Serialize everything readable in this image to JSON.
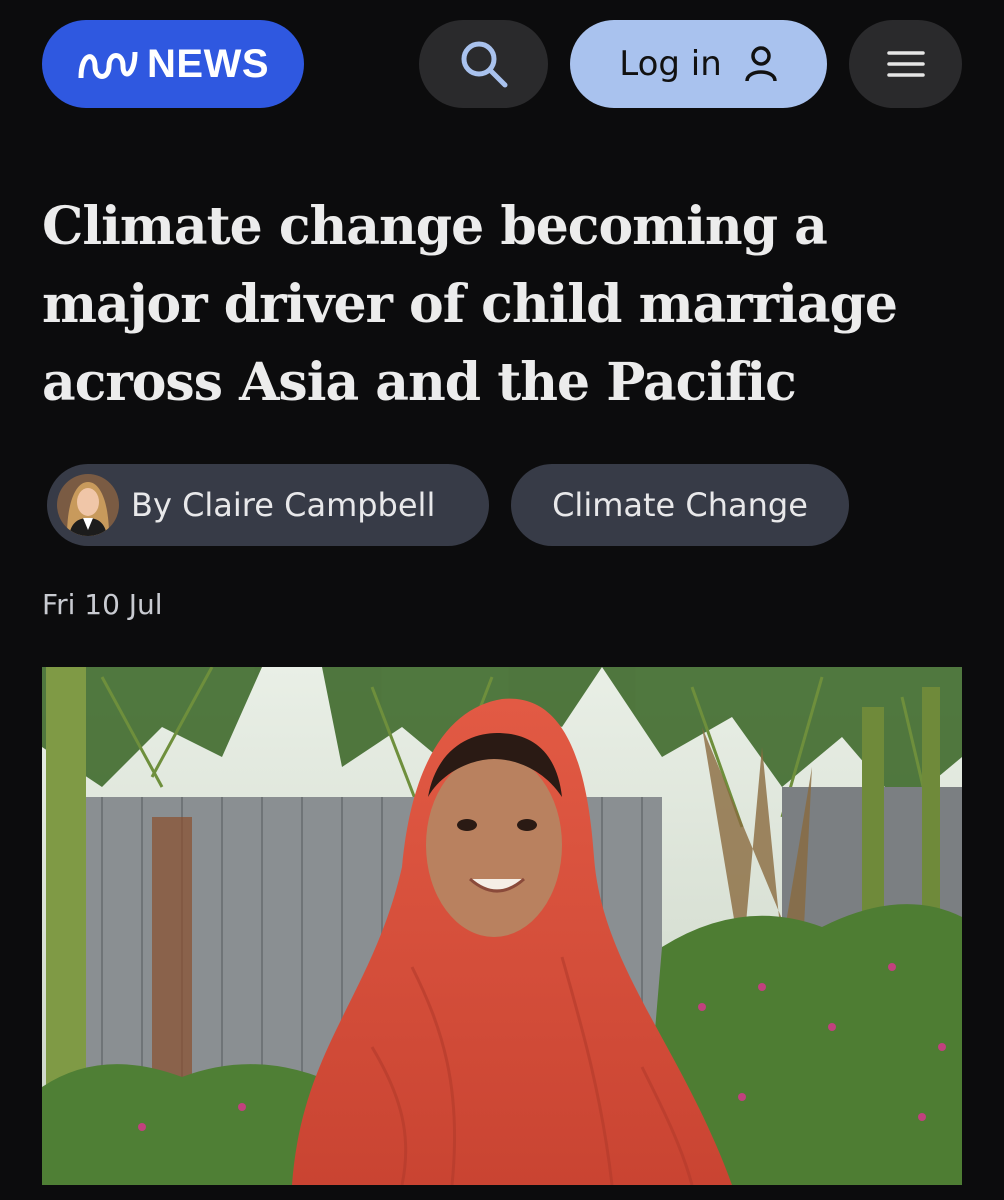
{
  "header": {
    "logo_text": "NEWS",
    "login_label": "Log in"
  },
  "article": {
    "headline": "Climate change becoming a major driver of child marriage across Asia and the Pacific",
    "author": "By Claire Campbell",
    "topic": "Climate Change",
    "date": "Fri 10 Jul"
  },
  "colors": {
    "logo_bg": "#2f58e0",
    "login_bg": "#a9c2ee",
    "page_bg": "#0c0c0d",
    "pill_bg": "#373b47"
  },
  "icons": {
    "search": "search-icon",
    "user": "user-icon",
    "menu": "hamburger-menu-icon",
    "logo": "abc-logo-mark"
  }
}
